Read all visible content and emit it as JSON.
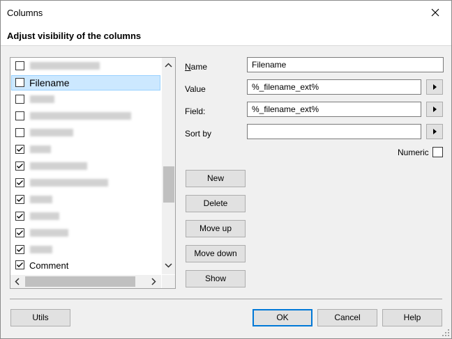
{
  "window": {
    "title": "Columns",
    "header": "Adjust visibility of the columns"
  },
  "columns_list": {
    "items": [
      {
        "label": "",
        "checked": false,
        "blurred": [
          {
            "w": 100
          }
        ]
      },
      {
        "label": "Filename",
        "checked": false,
        "selected": true
      },
      {
        "label": "",
        "checked": false,
        "blurred": [
          {
            "w": 35
          }
        ]
      },
      {
        "label": "",
        "checked": false,
        "blurred": [
          {
            "w": 145
          }
        ]
      },
      {
        "label": "",
        "checked": false,
        "blurred": [
          {
            "w": 62
          }
        ]
      },
      {
        "label": "",
        "checked": true,
        "blurred": [
          {
            "w": 30
          }
        ]
      },
      {
        "label": "",
        "checked": true,
        "blurred": [
          {
            "w": 82
          }
        ]
      },
      {
        "label": "",
        "checked": true,
        "blurred": [
          {
            "w": 112
          }
        ]
      },
      {
        "label": "",
        "checked": true,
        "blurred": [
          {
            "w": 32
          }
        ]
      },
      {
        "label": "",
        "checked": true,
        "blurred": [
          {
            "w": 42
          }
        ]
      },
      {
        "label": "",
        "checked": true,
        "blurred": [
          {
            "w": 55
          }
        ]
      },
      {
        "label": "",
        "checked": true,
        "blurred": [
          {
            "w": 32
          }
        ]
      },
      {
        "label": "Comment",
        "checked": true,
        "partial": true
      }
    ]
  },
  "form": {
    "name_label": "Name",
    "name_value": "Filename",
    "value_label": "Value",
    "value_value": "%_filename_ext%",
    "field_label": "Field:",
    "field_value": "%_filename_ext%",
    "sortby_label": "Sort by",
    "sortby_value": "",
    "numeric_label": "Numeric"
  },
  "buttons": {
    "new": "New",
    "delete": "Delete",
    "move_up": "Move up",
    "move_down": "Move down",
    "show": "Show",
    "utils": "Utils",
    "ok": "OK",
    "cancel": "Cancel",
    "help": "Help"
  },
  "icons": {
    "close": "close-icon",
    "arrow_right": "triangle-right-icon",
    "check": "check-icon"
  }
}
